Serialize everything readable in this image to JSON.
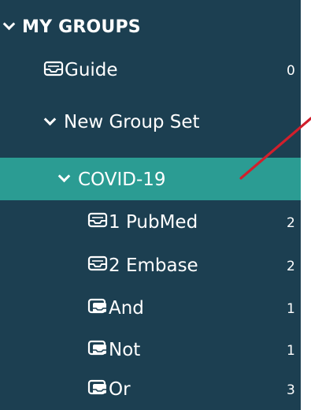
{
  "tree": {
    "header": {
      "label": "MY GROUPS"
    },
    "guide": {
      "label": "Guide",
      "count": "0",
      "icon": "group-tray-icon"
    },
    "group_set": {
      "label": "New Group Set"
    },
    "covid": {
      "label": "COVID-19",
      "selected": true
    },
    "children": [
      {
        "label": "1 PubMed",
        "count": "2",
        "icon": "group-tray-icon"
      },
      {
        "label": "2 Embase",
        "count": "2",
        "icon": "group-tray-icon"
      },
      {
        "label": "And",
        "count": "1",
        "icon": "combined-group-icon"
      },
      {
        "label": "Not",
        "count": "1",
        "icon": "combined-group-icon"
      },
      {
        "label": "Or",
        "count": "3",
        "icon": "combined-group-icon"
      }
    ]
  },
  "colors": {
    "panel_bg": "#1c3f51",
    "selected_bg": "#2b9c93",
    "pointer_line": "#d11f2c"
  }
}
